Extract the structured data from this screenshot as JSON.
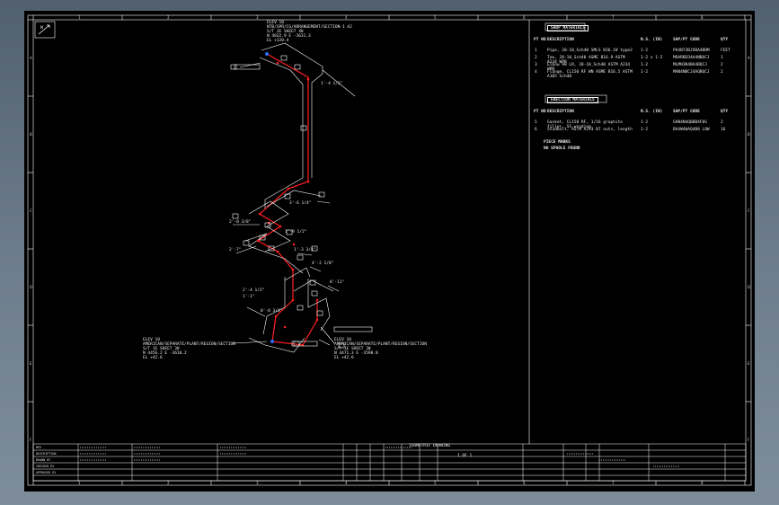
{
  "drawing": {
    "north_arrow": "N",
    "cut_list_title": "SHOP MATERIALS",
    "cut_list_headers": [
      "PT NO",
      "DESCRIPTION",
      "N.S. (IN)",
      "SAP/PT CODE",
      "QTY"
    ],
    "cut_list_rows": [
      {
        "pt": "1",
        "desc": "Pipe, 20-10_Sch40 SMLS B36.10 type2",
        "ns": "1-2",
        "code": "PA4N73BJVBA4BBM",
        "qty": "FEET"
      },
      {
        "pt": "2",
        "desc": "Tee, 20-10_Sch40 ASME B16.9 ASTM A234 WPB",
        "ns": "1-2 x 1-2",
        "code": "MOARBEO4A4NBOCJ",
        "qty": "1"
      },
      {
        "pt": "3",
        "desc": "Elbow 90 LR, 20-10_Sch40 ASTM A234 WPB",
        "ns": "1-2",
        "code": "MLMN3N4BA4BQCJ",
        "qty": "2"
      },
      {
        "pt": "4",
        "desc": "Flange, CL150 RF WN ASME B16.5 ASTM A105 Sch40",
        "ns": "1-2",
        "code": "MAN4NBCJ4AQBQCJ",
        "qty": "2"
      }
    ],
    "fabrication_title": "ERECTION MATERIALS",
    "fabrication_headers": [
      "PT NO",
      "DESCRIPTION",
      "N.S. (IN)",
      "SAP/PT CODE",
      "QTY"
    ],
    "fabrication_rows": [
      {
        "pt": "5",
        "desc": "Gasket, CL150 RF, 1/16 graphite filler, SS winding",
        "ns": "1-2",
        "code": "GAN4N4QBBB4F0S",
        "qty": "2"
      },
      {
        "pt": "6",
        "desc": "Studbolt, ASTM A193 B7 nuts, length",
        "ns": "1-2",
        "code": "BA4W4WAQ4B0 L8W",
        "qty": "16"
      }
    ],
    "piece_marks_title": "PIECE MARKS",
    "piece_marks_value": "NO SPOOLS FOUND",
    "callout_top": [
      "ELEV 10",
      "NTB/SPR/CG/ARRANGEMENT/SECTION-1 A2",
      "S/T 2E SHEET 40",
      "N 4832.9 E -3631.3",
      "EL +120.4"
    ],
    "callout_bl": [
      "ELEV 10",
      "AMERICAN/SEPARATE/PLANT/REGION/SECTION",
      "S/T 1E SHEET 30",
      "N 4456.2 E -3610.2",
      "EL +42.6"
    ],
    "callout_br": [
      "ELEV 10",
      "AMERICAN/SEPARATE/PLANT/REGION/SECTION",
      "S/T 1E SHEET 30",
      "N 4471.3 E -3590.8",
      "EL +42.6"
    ],
    "dim_labels": [
      "1'-4 1/2\"",
      "3'-6 1/4\"",
      "2'-0 3/8\"",
      "1'-9 1/2\"",
      "2'-7\"",
      "1'-3 3/4\"",
      "4'-2 1/8\"",
      "0'-11\"",
      "2'-4 1/2\"",
      "1'-1\"",
      "0'-8 3/4\""
    ],
    "grid_top": [
      "1",
      "2",
      "3",
      "4",
      "5",
      "6",
      "7",
      "8"
    ],
    "grid_side": [
      "A",
      "B",
      "C",
      "D",
      "E",
      "F"
    ],
    "title_block": {
      "rows_left": [
        "REV",
        "DESCRIPTION",
        "DRAWN BY",
        "CHECKED BY",
        "APPROVED BY"
      ],
      "project": "ISOMETRIC DRAWING",
      "sheet": "1 OF 1"
    }
  }
}
